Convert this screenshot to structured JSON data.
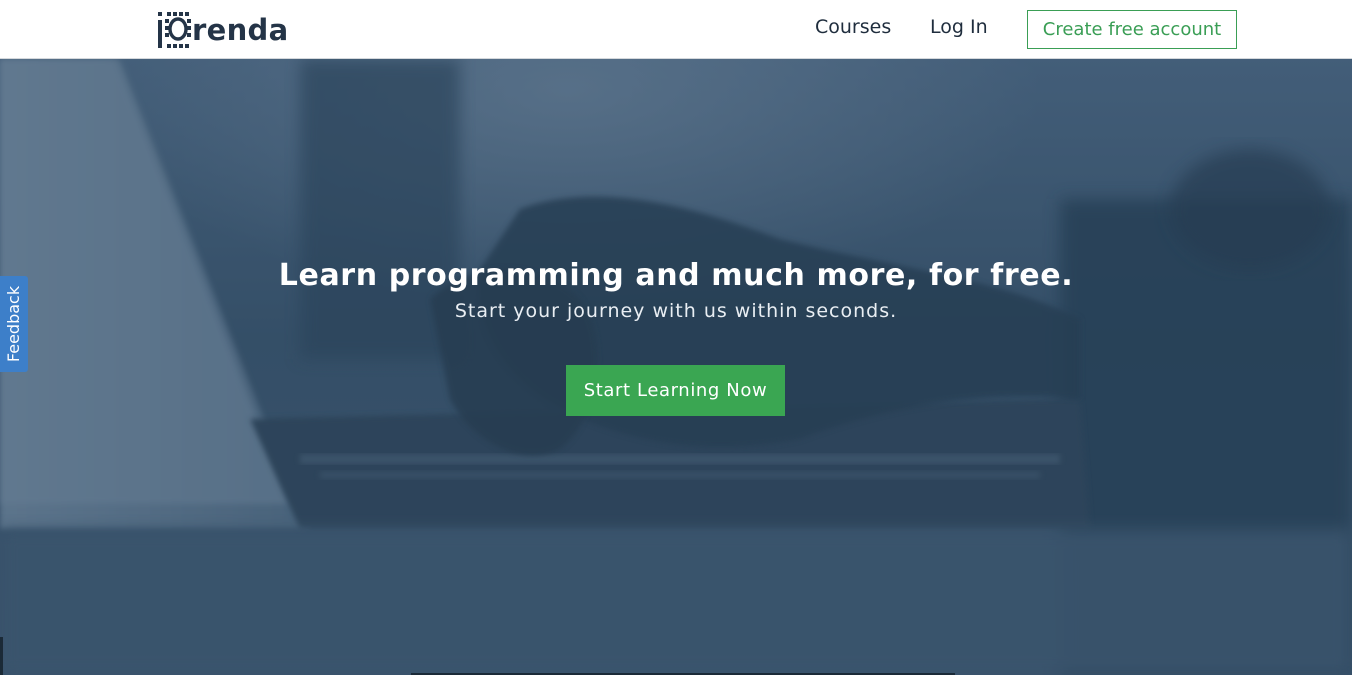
{
  "brand": {
    "logo_text": "renda",
    "colors": {
      "navy": "#243447",
      "accent_green": "#3aa652",
      "feedback_blue": "#3d7fc9"
    }
  },
  "nav": {
    "courses": "Courses",
    "login": "Log In",
    "create_account": "Create free account"
  },
  "hero": {
    "headline": "Learn programming and much more, for free.",
    "subheadline": "Start your journey with us within seconds.",
    "cta": "Start Learning Now"
  },
  "feedback": {
    "label": "Feedback"
  },
  "icons": {
    "logo": "iorenda-logo-icon"
  }
}
